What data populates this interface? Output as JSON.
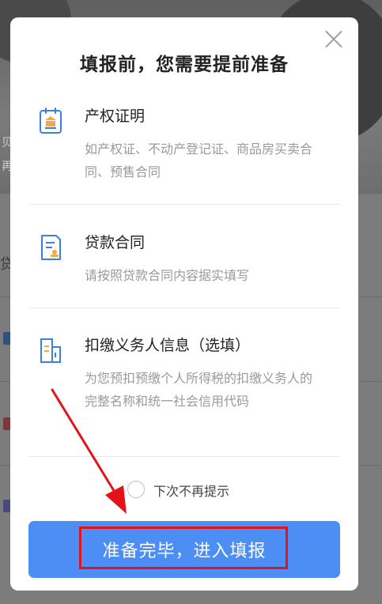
{
  "background": {
    "hero_text_1": "贝",
    "hero_text_2": "再",
    "side_text": "贷"
  },
  "modal": {
    "title": "填报前，您需要提前准备",
    "items": [
      {
        "title": "产权证明",
        "desc": "如产权证、不动产登记证、商品房买卖合同、预售合同",
        "icon": "certificate-icon"
      },
      {
        "title": "贷款合同",
        "desc": "请按照贷款合同内容据实填写",
        "icon": "contract-icon"
      },
      {
        "title": "扣缴义务人信息（选填）",
        "desc": "为您预扣预缴个人所得税的扣缴义务人的完整名称和统一社会信用代码",
        "icon": "building-icon"
      }
    ],
    "checkbox_label": "下次不再提示",
    "checkbox_checked": false,
    "primary_button": "准备完毕，进入填报"
  },
  "colors": {
    "primary": "#4d8ef5",
    "icon_blue": "#3b7ee8",
    "icon_orange": "#f0a94a",
    "annotation_red": "#e4131b"
  }
}
